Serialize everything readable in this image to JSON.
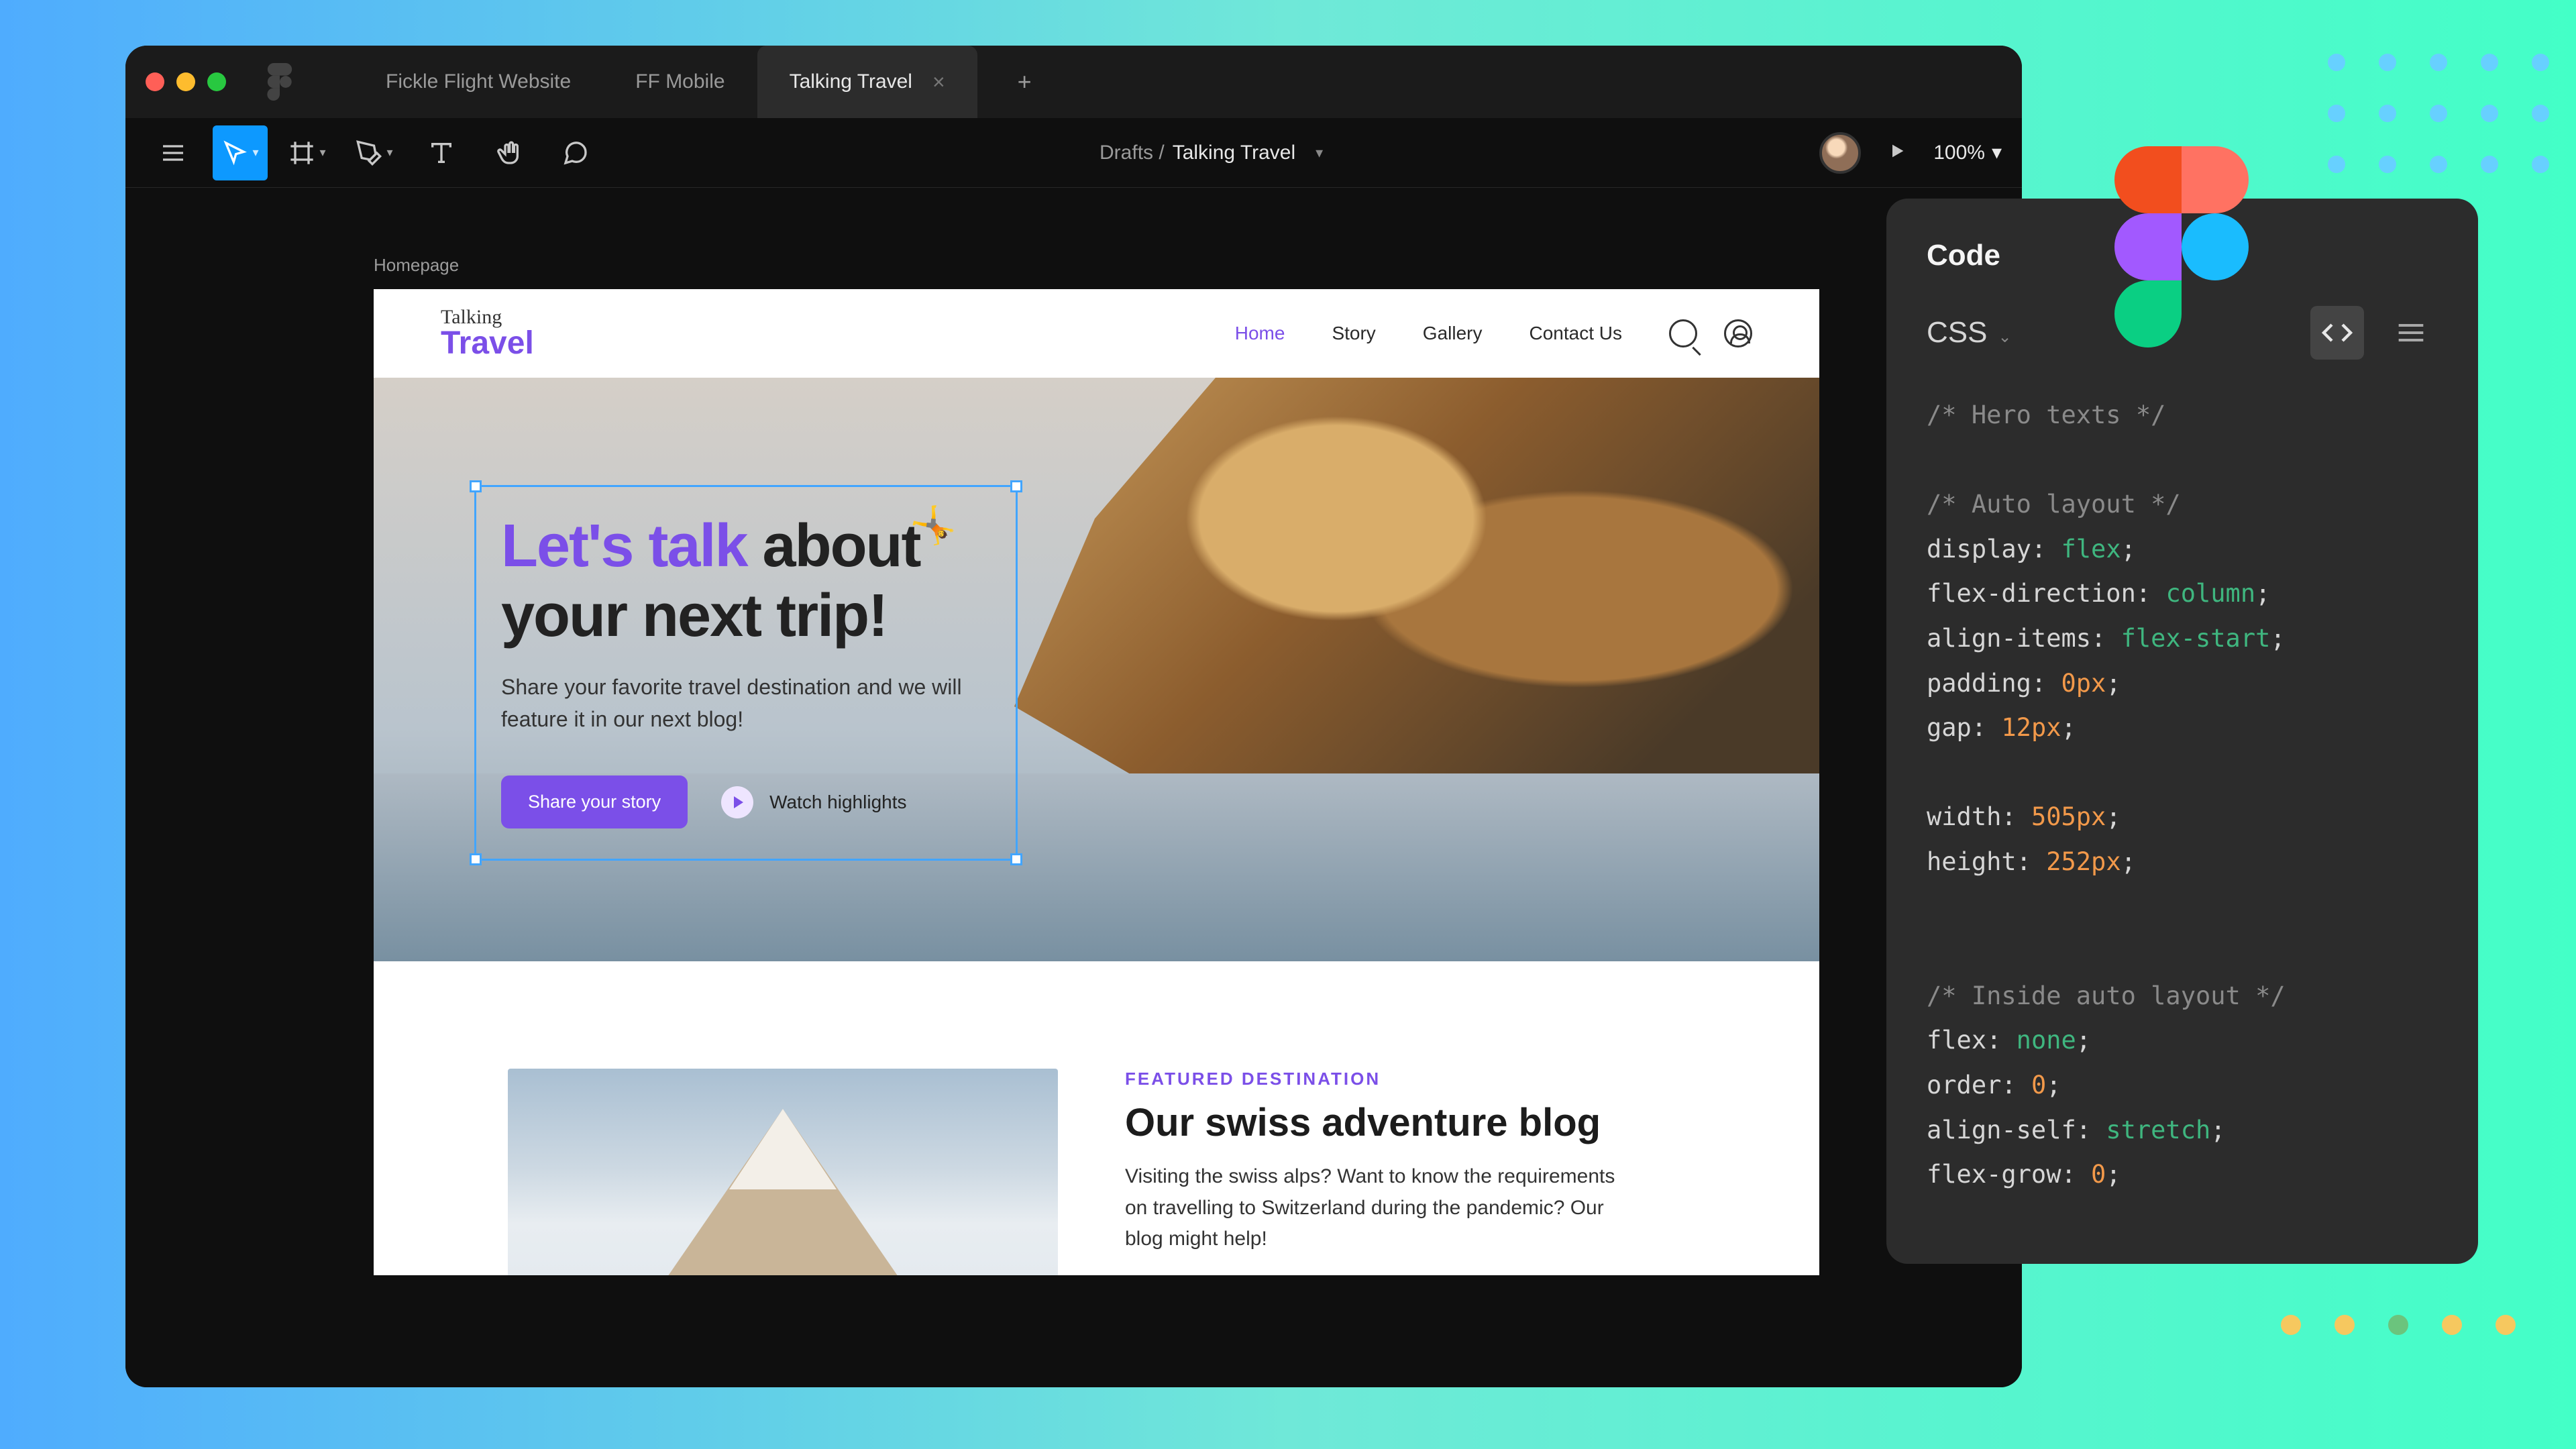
{
  "tabs": [
    {
      "label": "Fickle Flight Website"
    },
    {
      "label": "FF Mobile"
    },
    {
      "label": "Talking Travel"
    }
  ],
  "toolbar": {
    "location_prefix": "Drafts /",
    "project": "Talking Travel",
    "zoom": "100%"
  },
  "canvas": {
    "frame_label": "Homepage"
  },
  "site": {
    "logo_cursive": "Talking",
    "logo_main": "Travel",
    "nav": [
      {
        "label": "Home"
      },
      {
        "label": "Story"
      },
      {
        "label": "Gallery"
      },
      {
        "label": "Contact Us"
      }
    ]
  },
  "hero": {
    "title_accent": "Let's talk",
    "title_rest": " about your next trip!",
    "subtitle": "Share your favorite travel destination and we will feature it in our next blog!",
    "cta": "Share your story",
    "secondary": "Watch highlights"
  },
  "featured": {
    "eyebrow": "FEATURED DESTINATION",
    "title": "Our swiss adventure blog",
    "body": "Visiting the swiss alps? Want to know the requirements on travelling to Switzerland during the pandemic? Our blog might help!"
  },
  "code_panel": {
    "title": "Code",
    "language": "CSS",
    "lines": [
      {
        "comment": "/* Hero texts */"
      },
      {
        "blank": true
      },
      {
        "comment": "/* Auto layout */"
      },
      {
        "prop": "display",
        "value": "flex",
        "value_type": "kw"
      },
      {
        "prop": "flex-direction",
        "value": "column",
        "value_type": "kw"
      },
      {
        "prop": "align-items",
        "value": "flex-start",
        "value_type": "kw"
      },
      {
        "prop": "padding",
        "value": "0px",
        "value_type": "num"
      },
      {
        "prop": "gap",
        "value": "12px",
        "value_type": "num"
      },
      {
        "blank": true
      },
      {
        "prop": "width",
        "value": "505px",
        "value_type": "num"
      },
      {
        "prop": "height",
        "value": "252px",
        "value_type": "num"
      },
      {
        "blank": true
      },
      {
        "blank": true
      },
      {
        "comment": "/* Inside auto layout */"
      },
      {
        "prop": "flex",
        "value": "none",
        "value_type": "kw"
      },
      {
        "prop": "order",
        "value": "0",
        "value_type": "num"
      },
      {
        "prop": "align-self",
        "value": "stretch",
        "value_type": "kw"
      },
      {
        "prop": "flex-grow",
        "value": "0",
        "value_type": "num"
      }
    ]
  },
  "colors": {
    "accent_purple": "#7b4fe8",
    "figma_blue": "#0d99ff"
  }
}
